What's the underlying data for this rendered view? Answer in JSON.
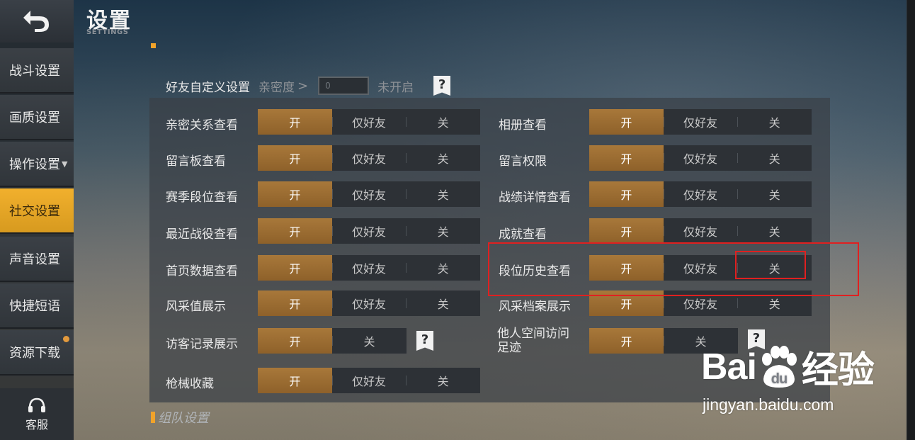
{
  "header": {
    "title": "设置",
    "subtitle": "SETTINGS"
  },
  "sidebar": {
    "items": [
      {
        "label": "战斗设置"
      },
      {
        "label": "画质设置"
      },
      {
        "label": "操作设置",
        "caret": "▼"
      },
      {
        "label": "社交设置",
        "active": true
      },
      {
        "label": "声音设置"
      },
      {
        "label": "快捷短语"
      },
      {
        "label": "资源下载",
        "dot": true
      }
    ],
    "service": {
      "label": "客服",
      "icon": "headset-icon"
    }
  },
  "friend_custom": {
    "label": "好友自定义设置",
    "intimacy_label": "亲密度",
    "gt": ">",
    "input_value": "0",
    "status": "未开启",
    "help": "?"
  },
  "options": {
    "on": "开",
    "friends": "仅好友",
    "off": "关"
  },
  "rows_left": [
    {
      "label": "亲密关系查看",
      "mode": 3
    },
    {
      "label": "留言板查看",
      "mode": 3
    },
    {
      "label": "赛季段位查看",
      "mode": 3
    },
    {
      "label": "最近战役查看",
      "mode": 3
    },
    {
      "label": "首页数据查看",
      "mode": 3
    },
    {
      "label": "风采值展示",
      "mode": 3
    },
    {
      "label": "访客记录展示",
      "mode": 2,
      "help": "?"
    },
    {
      "label": "枪械收藏",
      "mode": 3
    }
  ],
  "rows_right": [
    {
      "label": "相册查看",
      "mode": 3
    },
    {
      "label": "留言权限",
      "mode": 3
    },
    {
      "label": "战绩详情查看",
      "mode": 3
    },
    {
      "label": "成就查看",
      "mode": 3
    },
    {
      "label": "段位历史查看",
      "mode": 3
    },
    {
      "label": "风采档案展示",
      "mode": 3
    },
    {
      "label_line1": "他人空间访问",
      "label_line2": "足迹",
      "mode": 2,
      "help": "?"
    }
  ],
  "team_section": {
    "label": "组队设置"
  },
  "watermark": {
    "brand_left": "Bai",
    "brand_mid": "du",
    "brand_right": "经验",
    "url": "jingyan.baidu.com"
  },
  "colors": {
    "accent": "#f1b02d",
    "toggle_on": "#a8783a",
    "highlight": "#e02020"
  }
}
